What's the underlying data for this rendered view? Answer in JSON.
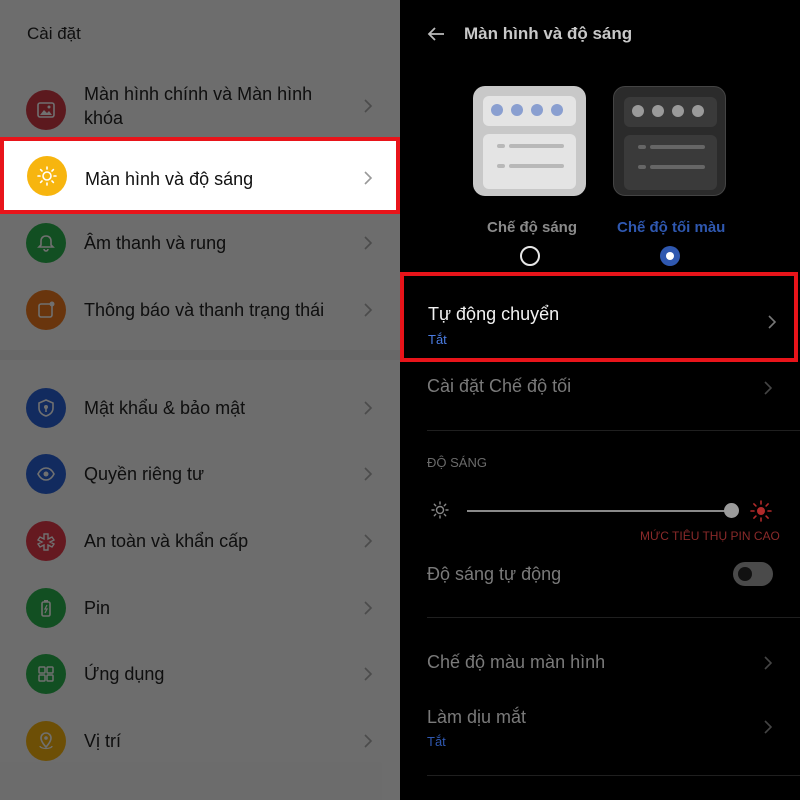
{
  "left": {
    "title": "Cài đặt",
    "items": [
      {
        "label": "Màn hình chính và Màn hình\nkhóa",
        "icon": "wallpaper-icon",
        "color": "#d23a46"
      },
      {
        "label": "Màn hình và độ sáng",
        "icon": "sun-icon",
        "color": "#f7b50f",
        "highlighted": true
      },
      {
        "label": "Âm thanh và rung",
        "icon": "bell-icon",
        "color": "#2bb34e"
      },
      {
        "label": "Thông báo và thanh trạng thái",
        "icon": "notification-icon",
        "color": "#f07a1e"
      },
      {
        "label": "Mật khẩu & bảo mật",
        "icon": "shield-icon",
        "color": "#2b63d8"
      },
      {
        "label": "Quyền riêng tư",
        "icon": "privacy-eye-icon",
        "color": "#2b63d8"
      },
      {
        "label": "An toàn và khẩn cấp",
        "icon": "emergency-icon",
        "color": "#e5394a"
      },
      {
        "label": "Pin",
        "icon": "battery-icon",
        "color": "#2bb34e"
      },
      {
        "label": "Ứng dụng",
        "icon": "apps-grid-icon",
        "color": "#2bb34e"
      },
      {
        "label": "Vị trí",
        "icon": "location-icon",
        "color": "#f7b50f"
      }
    ]
  },
  "right": {
    "title": "Màn hình và độ sáng",
    "modes": {
      "light_label": "Chế độ sáng",
      "dark_label": "Chế độ tối màu",
      "selected": "dark"
    },
    "auto_switch": {
      "title": "Tự động chuyển",
      "value": "Tắt"
    },
    "dark_settings": "Cài đặt Chế độ tối",
    "brightness_section": "ĐỘ SÁNG",
    "brightness_level": 0.99,
    "power_warning": "MỨC TIÊU THỤ PIN CAO",
    "auto_brightness": "Độ sáng tự động",
    "auto_brightness_on": false,
    "color_mode": "Chế độ màu màn hình",
    "eye_comfort": {
      "title": "Làm dịu mắt",
      "value": "Tắt"
    }
  },
  "colors": {
    "highlight_border": "#e8141a",
    "accent_blue": "#2f58b0"
  }
}
